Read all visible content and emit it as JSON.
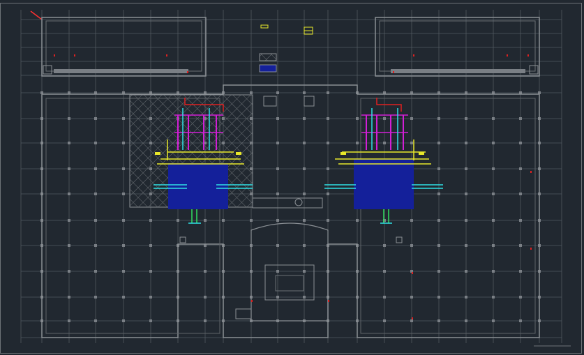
{
  "app": {
    "title": "",
    "canvas_background": "#212830"
  },
  "colors": {
    "grid": "#515860",
    "walls": "#8a8f94",
    "hatch": "#6b7075",
    "duct_magenta": "#d21fd6",
    "duct_yellow": "#e8e82a",
    "duct_cyan": "#2fe0e6",
    "duct_red": "#e02020",
    "duct_green": "#30e060",
    "blue_fill": "#14209a",
    "crosshair": "#ff3030"
  },
  "icons": {
    "crosshair": "crosshair-icon",
    "north_arrow": "north-arrow-icon"
  },
  "layers": [
    "axis-grid",
    "building-outline",
    "hatch-regions",
    "hvac-ducts",
    "equipment-blocks"
  ]
}
